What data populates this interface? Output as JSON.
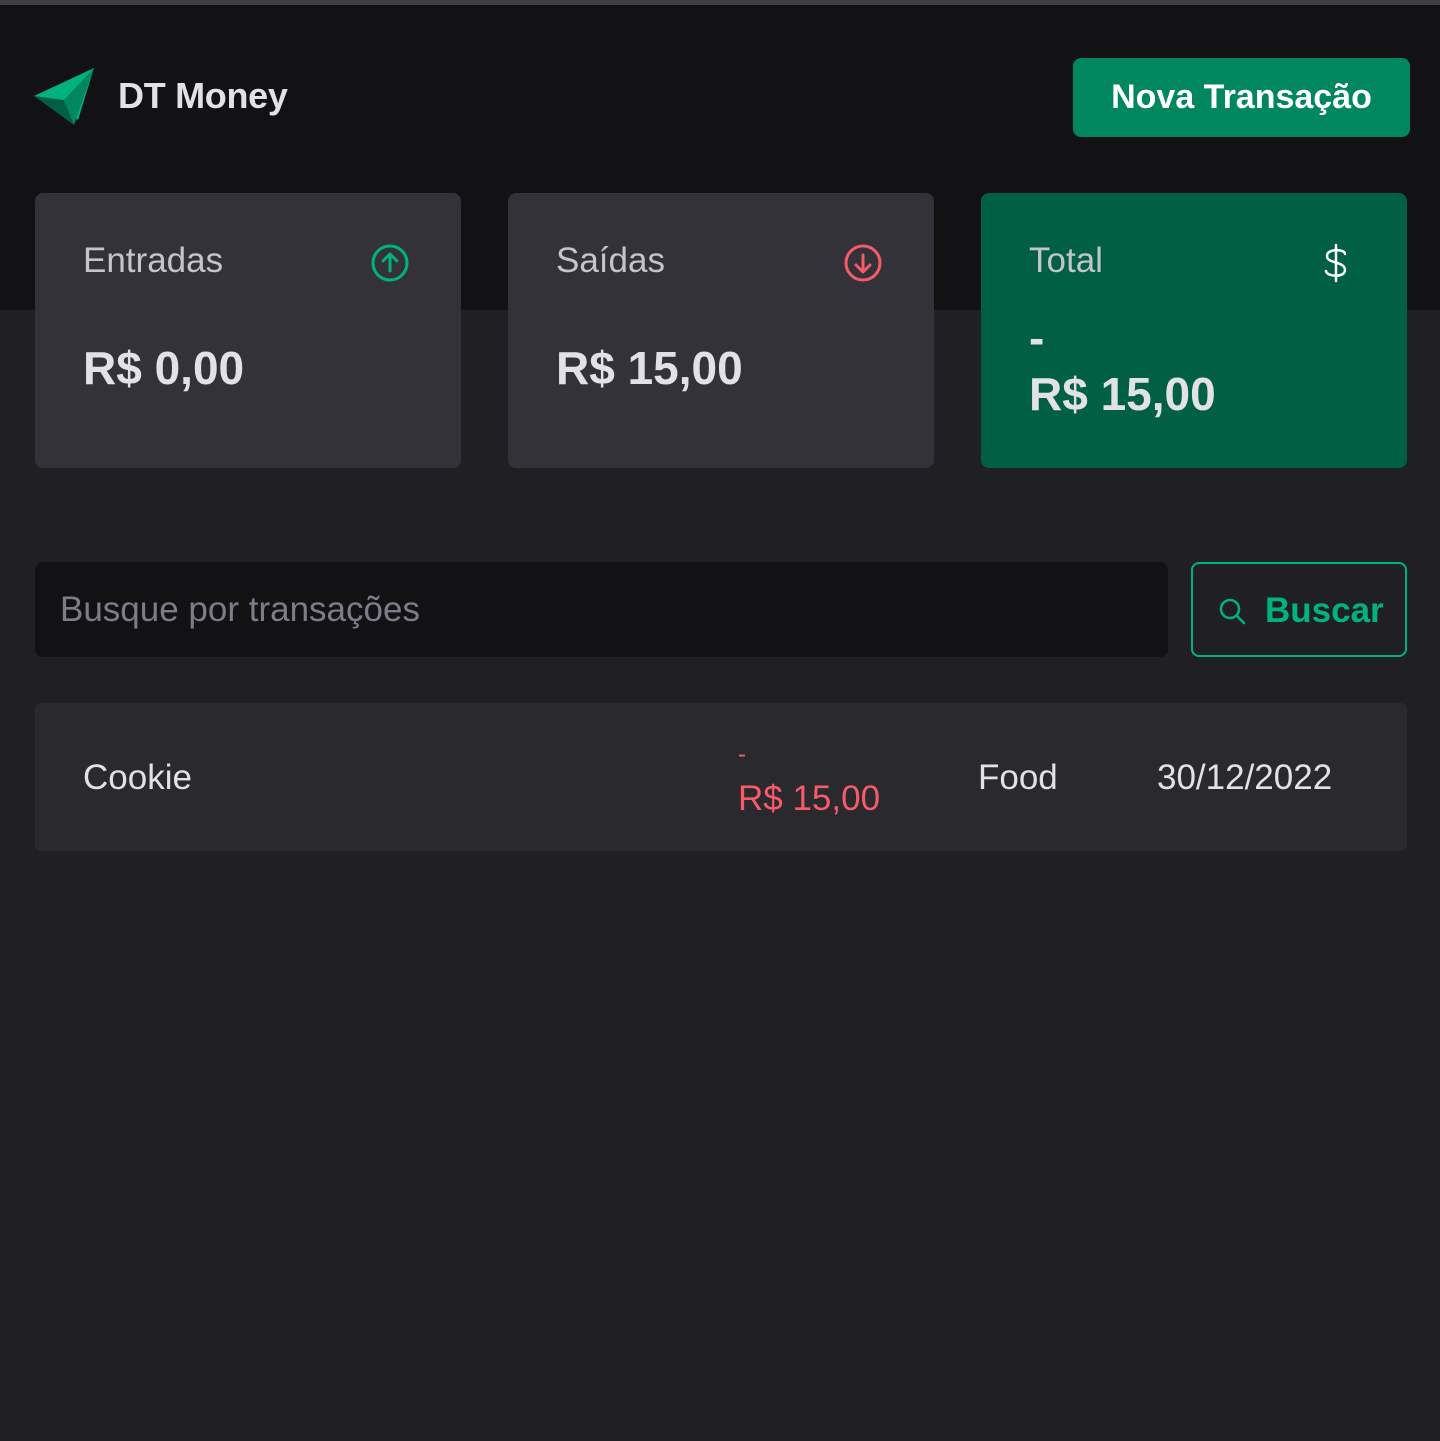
{
  "header": {
    "brand": "DT Money",
    "new_transaction_label": "Nova Transação"
  },
  "summary": {
    "income": {
      "label": "Entradas",
      "value": "R$ 0,00",
      "icon": "arrow-circle-up-icon",
      "color": "#00b37e"
    },
    "outcome": {
      "label": "Saídas",
      "value": "R$ 15,00",
      "icon": "arrow-circle-down-icon",
      "color": "#f75a68"
    },
    "total": {
      "label": "Total",
      "sign": "-",
      "value": "R$ 15,00",
      "icon": "dollar-sign-icon",
      "color": "#015f43"
    }
  },
  "search": {
    "placeholder": "Busque por transações",
    "value": "",
    "button_label": "Buscar"
  },
  "transactions": [
    {
      "description": "Cookie",
      "sign": "-",
      "amount": "R$ 15,00",
      "category": "Food",
      "date": "30/12/2022"
    }
  ],
  "colors": {
    "accent": "#00875f",
    "accent_light": "#00b37e",
    "danger": "#f75a68",
    "background": "#202024",
    "header_background": "#121214",
    "card": "#323238"
  }
}
